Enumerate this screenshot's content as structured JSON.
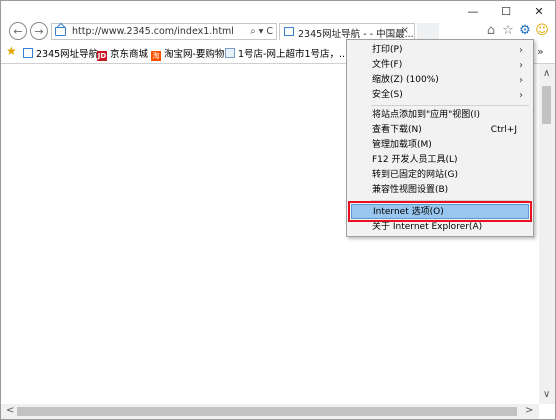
{
  "window": {
    "minimize": "—",
    "maximize": "☐",
    "close": "✕"
  },
  "nav": {
    "back_icon": "←",
    "forward_icon": "→",
    "address": "http://www.2345.com/index1.html",
    "address_tools": "⌕ ▾ C",
    "tab_title": "2345网址导航 - - 中国最...",
    "tab_close": "×"
  },
  "toolbar": {
    "home_icon": "⌂",
    "favorites_icon": "☆",
    "tools_icon": "⚙",
    "smiley_icon": "☺"
  },
  "favorites": {
    "star": "★",
    "items": [
      {
        "icon": "home",
        "label": "2345网址导航"
      },
      {
        "icon": "JD",
        "label": "京东商城"
      },
      {
        "icon": "淘",
        "label": "淘宝网-要购物"
      },
      {
        "icon": "ie",
        "label": "1号店-网上超市1号店，..."
      }
    ],
    "more": "»"
  },
  "scroll": {
    "up": "∧",
    "down": "∨",
    "left": "<",
    "right": ">"
  },
  "menu": {
    "items": [
      {
        "label": "打印(P)",
        "submenu": "›"
      },
      {
        "label": "文件(F)",
        "submenu": "›"
      },
      {
        "label": "缩放(Z) (100%)",
        "submenu": "›"
      },
      {
        "label": "安全(S)",
        "submenu": "›"
      },
      {
        "label": "将站点添加到\"应用\"视图(I)"
      },
      {
        "label": "查看下载(N)",
        "accelerator": "Ctrl+J"
      },
      {
        "label": "管理加载项(M)"
      },
      {
        "label": "F12 开发人员工具(L)"
      },
      {
        "label": "转到已固定的网站(G)"
      },
      {
        "label": "兼容性视图设置(B)"
      },
      {
        "label": "Internet 选项(O)",
        "selected": true
      },
      {
        "label": "关于 Internet Explorer(A)"
      }
    ]
  }
}
